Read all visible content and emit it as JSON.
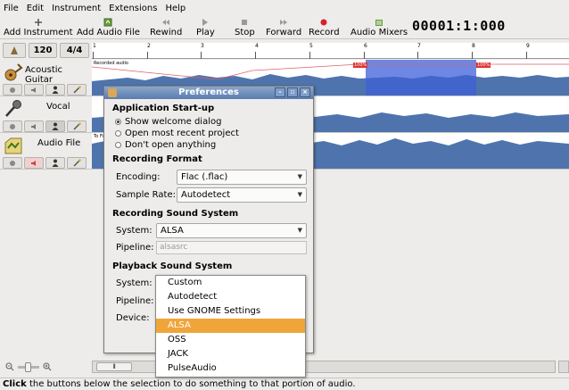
{
  "menu": [
    "File",
    "Edit",
    "Instrument",
    "Extensions",
    "Help"
  ],
  "toolbar": {
    "add_instrument": "Add Instrument",
    "add_audio_file": "Add Audio File",
    "rewind": "Rewind",
    "play": "Play",
    "stop": "Stop",
    "forward": "Forward",
    "record": "Record",
    "audio_mixers": "Audio Mixers",
    "counter": "00001:1:000"
  },
  "tempo": {
    "bpm": "120",
    "signature": "4/4"
  },
  "ruler_ticks": [
    "1",
    "2",
    "3",
    "4",
    "5",
    "6",
    "7",
    "8",
    "9"
  ],
  "tracks": [
    {
      "name": "Acoustic Guitar",
      "lane_label": "Recorded audio"
    },
    {
      "name": "Vocal",
      "lane_label": ""
    },
    {
      "name": "Audio File",
      "lane_label": "To File"
    }
  ],
  "selection_markers": [
    "100%",
    "100%"
  ],
  "dialog": {
    "title": "Preferences",
    "startup_header": "Application Start-up",
    "startup_options": [
      {
        "label": "Show welcome dialog",
        "checked": true
      },
      {
        "label": "Open most recent project",
        "checked": false
      },
      {
        "label": "Don't open anything",
        "checked": false
      }
    ],
    "format_header": "Recording Format",
    "encoding_label": "Encoding:",
    "encoding_value": "Flac (.flac)",
    "sample_rate_label": "Sample Rate:",
    "sample_rate_value": "Autodetect",
    "rec_system_header": "Recording Sound System",
    "rec_system_label": "System:",
    "rec_system_value": "ALSA",
    "rec_pipeline_label": "Pipeline:",
    "rec_pipeline_placeholder": "alsasrc",
    "play_system_header": "Playback Sound System",
    "play_system_label": "System:",
    "play_pipeline_label": "Pipeline:",
    "play_device_label": "Device:"
  },
  "dropdown": {
    "options": [
      "Custom",
      "Autodetect",
      "Use GNOME Settings",
      "ALSA",
      "OSS",
      "JACK",
      "PulseAudio"
    ],
    "selected": "ALSA"
  },
  "status_bold": "Click",
  "status_text": " the buttons below the selection to do something to that portion of audio.",
  "colors": {
    "waveform": "#4f74ad",
    "selection": "#3d5fd8",
    "dropdown_highlight": "#f0a53b",
    "title_bar": "#6a8bbd"
  }
}
